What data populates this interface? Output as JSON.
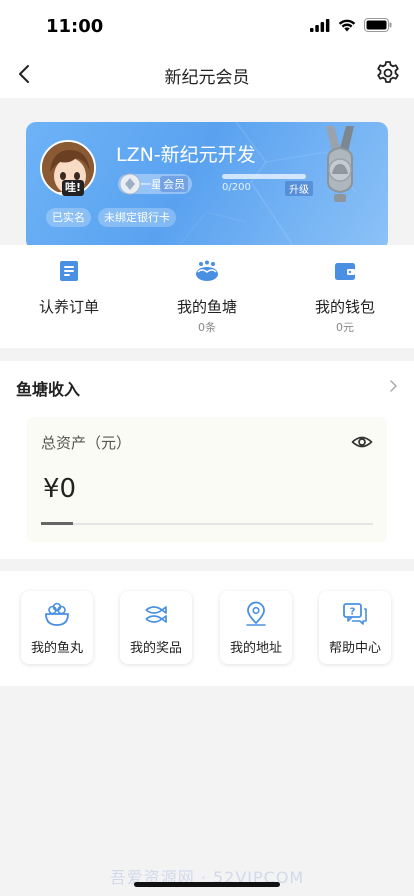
{
  "status": {
    "time": "11:00"
  },
  "nav": {
    "title": "新纪元会员"
  },
  "member": {
    "name": "LZN-新纪元开发",
    "avatar_badge": "哇!",
    "level_stars": "一星",
    "level_label": "会员",
    "progress_text": "0/200",
    "progress_fraction": 0,
    "upgrade_label": "升级",
    "tags": [
      "已实名",
      "未绑定银行卡"
    ]
  },
  "quick": [
    {
      "label": "认养订单",
      "sub": "",
      "icon": "clipboard-icon"
    },
    {
      "label": "我的鱼塘",
      "sub": "0条",
      "icon": "fish-pond-icon"
    },
    {
      "label": "我的钱包",
      "sub": "0元",
      "icon": "wallet-icon"
    }
  ],
  "pond": {
    "title": "鱼塘收入",
    "asset_label": "总资产（元）",
    "asset_value": "¥0"
  },
  "features": [
    {
      "label": "我的鱼丸",
      "icon": "fish-ball-bowl-icon"
    },
    {
      "label": "我的奖品",
      "icon": "fish-prize-icon"
    },
    {
      "label": "我的地址",
      "icon": "location-pin-icon"
    },
    {
      "label": "帮助中心",
      "icon": "help-chat-icon"
    }
  ],
  "watermark": "吾爱资源网 · 52VIPCOM",
  "colors": {
    "accent": "#4a90e2",
    "card_start": "#6eb3f7",
    "card_end": "#8cc2f7"
  }
}
